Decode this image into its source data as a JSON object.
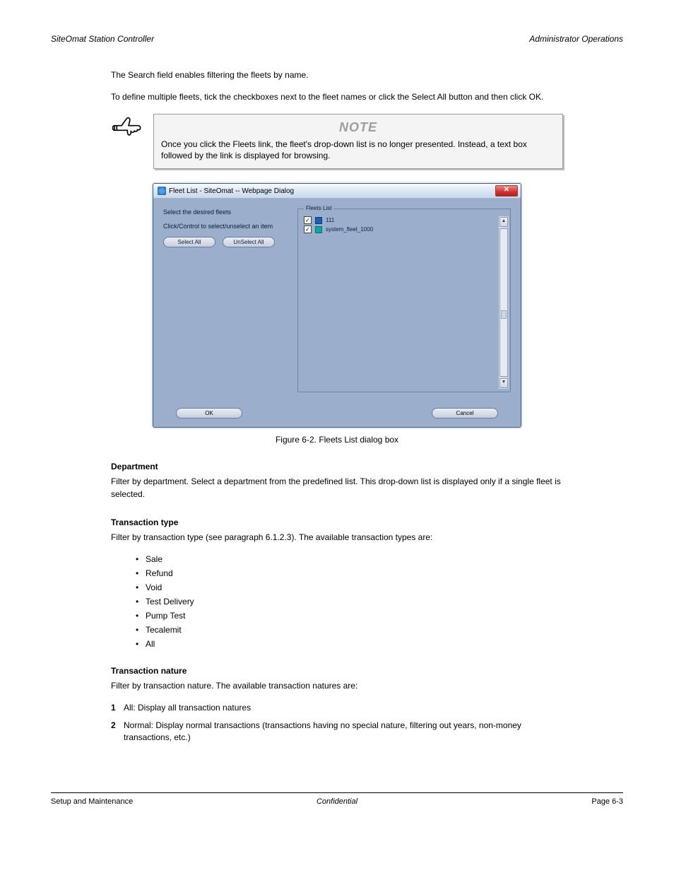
{
  "header": {
    "left": "SiteOmat Station Controller",
    "right": "Administrator Operations"
  },
  "intro1": "The Search field enables filtering the fleets by name.",
  "intro2": "To define multiple fleets, tick the checkboxes next to the fleet names or click the Select All button and then click OK.",
  "note": {
    "title": "NOTE",
    "body": "Once you click the Fleets link, the fleet's drop-down list is no longer presented. Instead, a text box followed by the link is displayed for browsing."
  },
  "dialog": {
    "title": "Fleet List - SiteOmat -- Webpage Dialog",
    "close_symbol": "✕",
    "left_lines": {
      "l1": "Select the desired fleets",
      "l2": "Click/Control to select/unselect an item"
    },
    "buttons": {
      "select_all": "Select All",
      "unselect_all": "UnSelect All",
      "ok": "OK",
      "cancel": "Cancel"
    },
    "fleets_legend": "Fleets List",
    "fleets": [
      {
        "checked": true,
        "color": "blue",
        "name": "111"
      },
      {
        "checked": true,
        "color": "teal",
        "name": "system_fleet_1000"
      }
    ],
    "scroll": {
      "up": "▲",
      "down": "▼"
    }
  },
  "figure_caption": "Figure 6-2. Fleets List dialog box",
  "department": {
    "title": "Department",
    "body": "Filter by department. Select a department from the predefined list. This drop-down list is displayed only if a single fleet is selected."
  },
  "transaction_type": {
    "title": "Transaction type",
    "body": "Filter by transaction type (see paragraph 6.1.2.3). The available transaction types are:",
    "items": [
      "Sale",
      "Refund",
      "Void",
      "Test Delivery",
      "Pump Test",
      "Tecalemit",
      "All"
    ]
  },
  "transaction_nature": {
    "title": "Transaction nature",
    "body": "Filter by transaction nature. The available transaction natures are:",
    "items": [
      {
        "n": "1",
        "row": "All: Display all transaction natures"
      },
      {
        "n": "2",
        "row": "Normal: Display normal transactions (transactions having no special nature, filtering out years, non-money transactions, etc.)"
      }
    ]
  },
  "footer": {
    "left": "Setup and Maintenance",
    "center": "Confidential",
    "right": "Page 6-3"
  }
}
